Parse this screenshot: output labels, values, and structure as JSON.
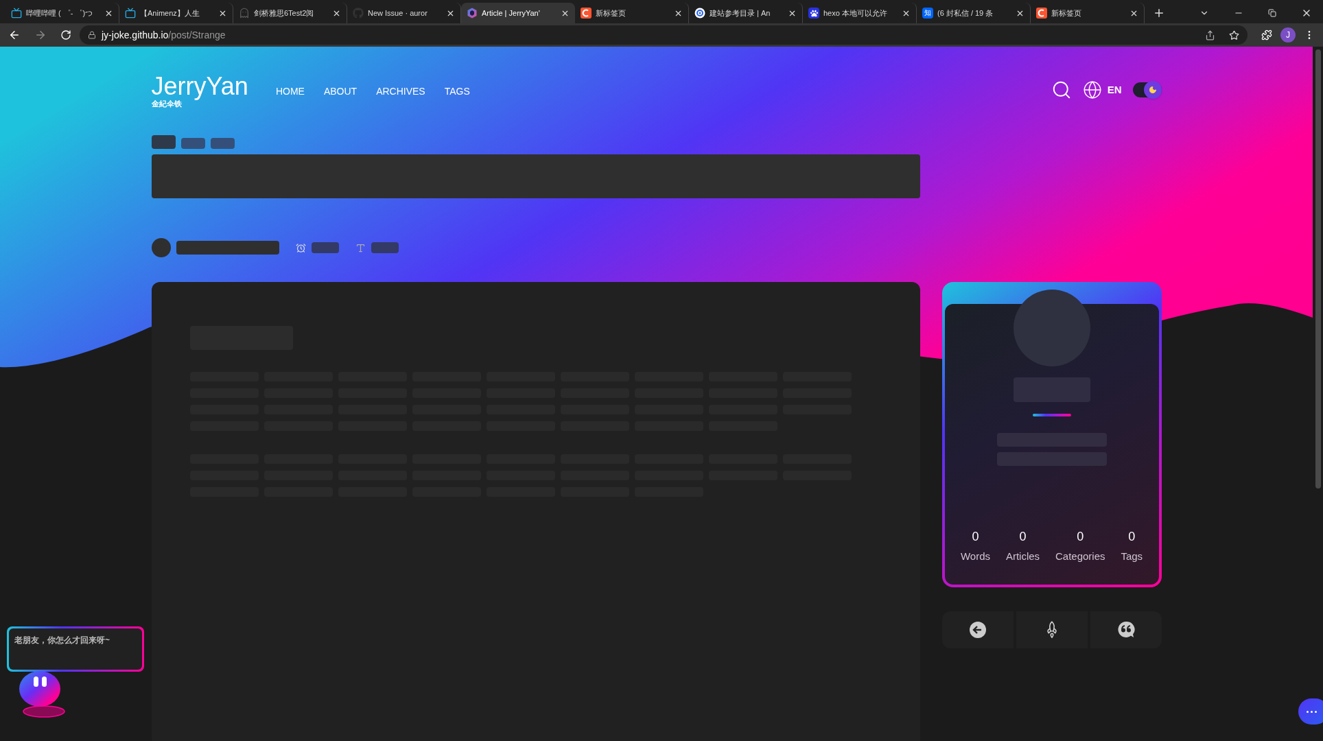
{
  "browser": {
    "tabs": [
      {
        "title": "哔哩哔哩 ( ゜- ゜)つ",
        "kind": "tv",
        "selected": false
      },
      {
        "title": "【Animenz】人生",
        "kind": "tv",
        "selected": false
      },
      {
        "title": "剑桥雅思6Test2阅",
        "kind": "ghost",
        "selected": false
      },
      {
        "title": "New Issue · auror",
        "kind": "github",
        "selected": false
      },
      {
        "title": "Article | JerryYan'",
        "kind": "hexagon",
        "selected": true
      },
      {
        "title": "新标签页",
        "kind": "c",
        "selected": false
      },
      {
        "title": "建站参考目录 | An",
        "kind": "compass",
        "selected": false
      },
      {
        "title": "hexo 本地可以允许",
        "kind": "paw",
        "selected": false
      },
      {
        "title": "(6 封私信 / 19 条",
        "kind": "zhi",
        "icon_text": "知",
        "selected": false
      },
      {
        "title": "新标签页",
        "kind": "c",
        "selected": false
      }
    ],
    "address": {
      "host": "jy-joke.github.io",
      "path": "/post/Strange"
    },
    "profile_initial": "J"
  },
  "site": {
    "logo": "JerryYan",
    "subtitle": "金紀伞铁",
    "nav": [
      "HOME",
      "ABOUT",
      "ARCHIVES",
      "TAGS"
    ],
    "language": "EN",
    "dark_mode": true
  },
  "profile_card": {
    "stats": [
      {
        "value": "0",
        "label": "Words"
      },
      {
        "value": "0",
        "label": "Articles"
      },
      {
        "value": "0",
        "label": "Categories"
      },
      {
        "value": "0",
        "label": "Tags"
      }
    ]
  },
  "mascot": {
    "message": "老朋友，你怎么才回来呀~"
  }
}
